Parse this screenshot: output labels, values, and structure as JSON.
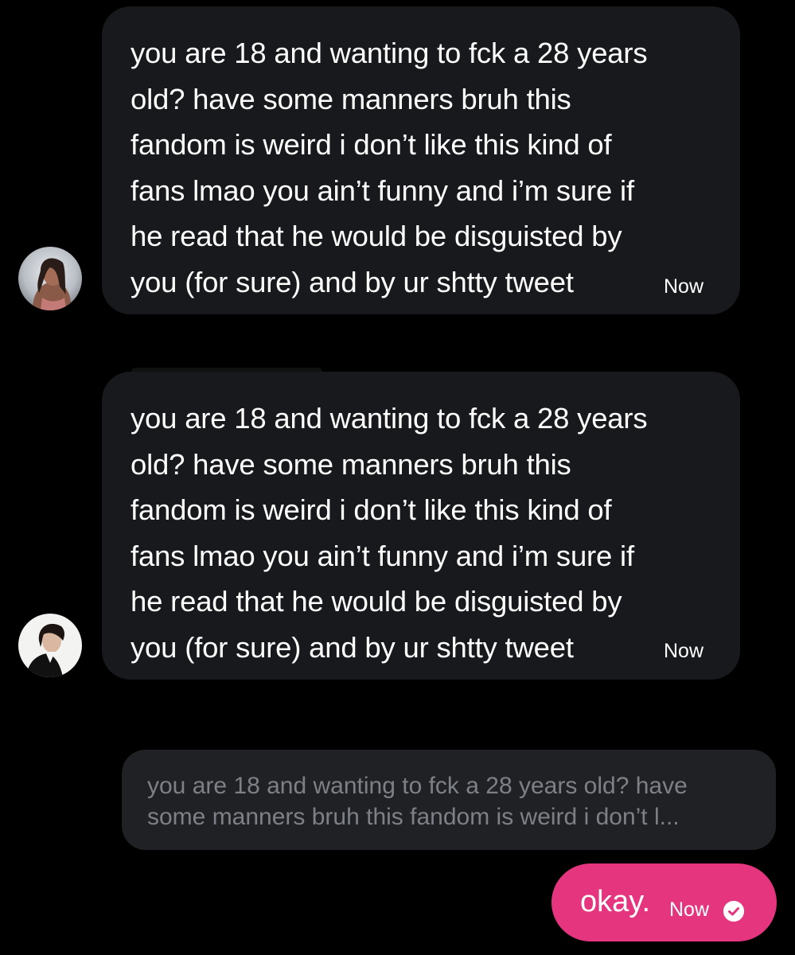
{
  "conversation": {
    "messages": [
      {
        "sender": "other-user-1",
        "lines": [
          "you are 18 and wanting to fck a 28 years",
          "old? have some manners bruh this",
          "fandom is weird i don’t like this kind of",
          "fans lmao you ain’t funny and i’m sure if",
          "he read that he would be disguisted by",
          "you (for sure) and by ur shtty tweet"
        ],
        "time": "Now"
      },
      {
        "sender": "other-user-2",
        "lines": [
          "you are 18 and wanting to fck a 28 years",
          "old? have some manners bruh this",
          "fandom is weird i don’t like this kind of",
          "fans lmao you ain’t funny and i’m sure if",
          "he read that he would be disguisted by",
          "you (for sure) and by ur shtty tweet"
        ],
        "time": "Now"
      }
    ],
    "reply_quote": {
      "lines": [
        "you are 18 and wanting to fck a 28 years old? have",
        "some manners bruh this fandom is weird i don’t l..."
      ]
    },
    "sent_message": {
      "text": "okay.",
      "time": "Now",
      "status_icon": "check-circle-icon"
    }
  },
  "colors": {
    "background": "#000000",
    "received_bubble": "#18191c",
    "quote_bubble": "#202124",
    "quote_text": "#7d8086",
    "sent_bubble": "#e5357f"
  }
}
